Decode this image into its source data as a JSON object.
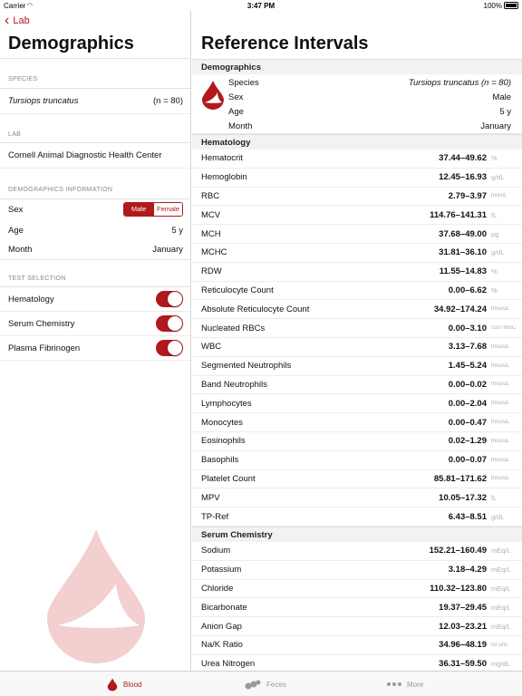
{
  "status": {
    "carrier": "Carrier",
    "time": "3:47 PM",
    "battery": "100%"
  },
  "left": {
    "back_label": "Lab",
    "title": "Demographics",
    "species_label": "SPECIES",
    "species_name": "Tursiops truncatus",
    "species_n": "(n = 80)",
    "lab_label": "LAB",
    "lab_name": "Cornell Animal Diagnostic Health Center",
    "demo_info_label": "DEMOGRAPHICS INFORMATION",
    "sex_label": "Sex",
    "sex_options": {
      "male": "Male",
      "female": "Female"
    },
    "sex_selected": "Male",
    "age_label": "Age",
    "age_value": "5 y",
    "month_label": "Month",
    "month_value": "January",
    "test_selection_label": "TEST SELECTION",
    "tests": [
      {
        "label": "Hematology",
        "enabled": true
      },
      {
        "label": "Serum Chemistry",
        "enabled": true
      },
      {
        "label": "Plasma Fibrinogen",
        "enabled": true
      }
    ]
  },
  "right": {
    "title": "Reference Intervals",
    "demographics": {
      "header": "Demographics",
      "species_label": "Species",
      "species_value": "Tursiops truncatus (n = 80)",
      "sex_label": "Sex",
      "sex_value": "Male",
      "age_label": "Age",
      "age_value": "5 y",
      "month_label": "Month",
      "month_value": "January"
    },
    "hematology": {
      "header": "Hematology",
      "rows": [
        {
          "name": "Hematocrit",
          "value": "37.44–49.62",
          "unit": "%"
        },
        {
          "name": "Hemoglobin",
          "value": "12.45–16.93",
          "unit": "g/dL"
        },
        {
          "name": "RBC",
          "value": "2.79–3.97",
          "unit": "mill/uL"
        },
        {
          "name": "MCV",
          "value": "114.76–141.31",
          "unit": "fL"
        },
        {
          "name": "MCH",
          "value": "37.68–49.00",
          "unit": "pg"
        },
        {
          "name": "MCHC",
          "value": "31.81–36.10",
          "unit": "g/dL"
        },
        {
          "name": "RDW",
          "value": "11.55–14.83",
          "unit": "%"
        },
        {
          "name": "Reticulocyte Count",
          "value": "0.00–6.62",
          "unit": "%"
        },
        {
          "name": "Absolute Reticulocyte Count",
          "value": "34.92–174.24",
          "unit": "thou/uL"
        },
        {
          "name": "Nucleated RBCs",
          "value": "0.00–3.10",
          "unit": "/100 WBC"
        },
        {
          "name": "WBC",
          "value": "3.13–7.68",
          "unit": "thou/uL"
        },
        {
          "name": "Segmented Neutrophils",
          "value": "1.45–5.24",
          "unit": "thou/uL"
        },
        {
          "name": "Band Neutrophils",
          "value": "0.00–0.02",
          "unit": "thou/uL"
        },
        {
          "name": "Lymphocytes",
          "value": "0.00–2.04",
          "unit": "thou/uL"
        },
        {
          "name": "Monocytes",
          "value": "0.00–0.47",
          "unit": "thou/uL"
        },
        {
          "name": "Eosinophils",
          "value": "0.02–1.29",
          "unit": "thou/uL"
        },
        {
          "name": "Basophils",
          "value": "0.00–0.07",
          "unit": "thou/uL"
        },
        {
          "name": "Platelet Count",
          "value": "85.81–171.62",
          "unit": "thou/uL"
        },
        {
          "name": "MPV",
          "value": "10.05–17.32",
          "unit": "fL"
        },
        {
          "name": "TP-Ref",
          "value": "6.43–8.51",
          "unit": "g/dL"
        }
      ]
    },
    "chemistry": {
      "header": "Serum Chemistry",
      "rows": [
        {
          "name": "Sodium",
          "value": "152.21–160.49",
          "unit": "mEq/L"
        },
        {
          "name": "Potassium",
          "value": "3.18–4.29",
          "unit": "mEq/L"
        },
        {
          "name": "Chloride",
          "value": "110.32–123.80",
          "unit": "mEq/L"
        },
        {
          "name": "Bicarbonate",
          "value": "19.37–29.45",
          "unit": "mEq/L"
        },
        {
          "name": "Anion Gap",
          "value": "12.03–23.21",
          "unit": "mEq/L"
        },
        {
          "name": "Na/K Ratio",
          "value": "34.96–48.19",
          "unit": "no unit"
        },
        {
          "name": "Urea Nitrogen",
          "value": "36.31–59.50",
          "unit": "mg/dL"
        }
      ]
    }
  },
  "tabbar": {
    "blood": "Blood",
    "feces": "Feces",
    "more": "More"
  },
  "colors": {
    "accent": "#b1191c"
  }
}
